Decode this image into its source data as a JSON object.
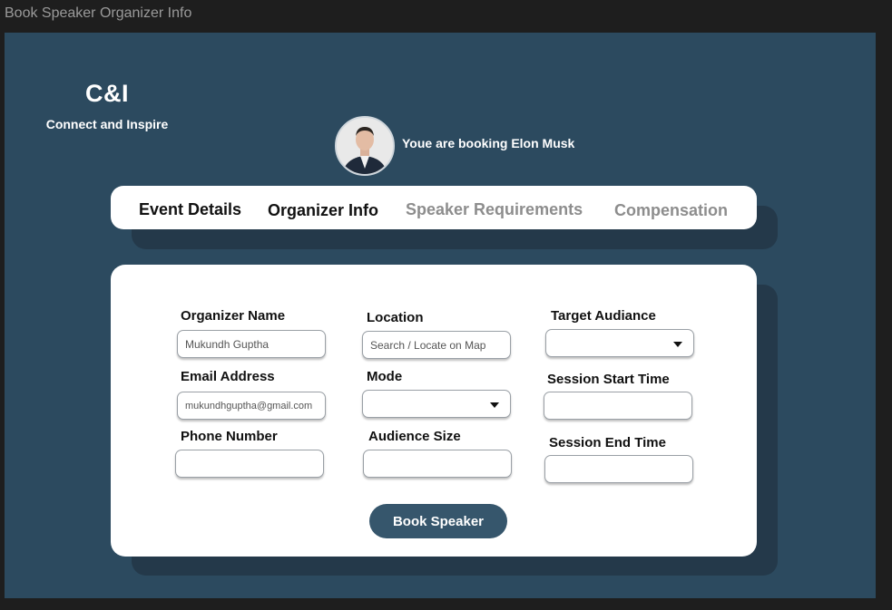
{
  "window": {
    "title": "Book Speaker Organizer Info"
  },
  "brand": {
    "logo": "C&I",
    "tagline": "Connect and Inspire"
  },
  "booking": {
    "text": "Youe are booking Elon Musk"
  },
  "tabs": [
    {
      "label": "Event Details",
      "state": "completed"
    },
    {
      "label": "Organizer Info",
      "state": "active"
    },
    {
      "label": "Speaker Requirements",
      "state": "inactive"
    },
    {
      "label": "Compensation",
      "state": "inactive"
    }
  ],
  "form": {
    "organizer_name": {
      "label": "Organizer Name",
      "value": "Mukundh Guptha"
    },
    "email": {
      "label": "Email Address",
      "value": "mukundhguptha@gmail.com"
    },
    "phone": {
      "label": "Phone Number",
      "value": ""
    },
    "location": {
      "label": "Location",
      "placeholder": "Search / Locate on Map"
    },
    "mode": {
      "label": "Mode",
      "value": ""
    },
    "audience_size": {
      "label": "Audience Size",
      "value": ""
    },
    "target_audience": {
      "label": "Target Audiance",
      "value": ""
    },
    "session_start": {
      "label": "Session Start Time",
      "value": ""
    },
    "session_end": {
      "label": "Session End Time",
      "value": ""
    },
    "submit_label": "Book Speaker"
  },
  "colors": {
    "page_bg": "#2c4a5f",
    "card_bg": "#ffffff",
    "button_bg": "#36566c",
    "muted_tab": "#8d8d8d"
  }
}
